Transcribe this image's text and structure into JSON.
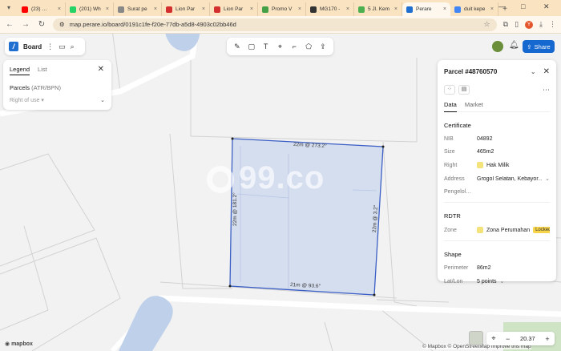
{
  "browser": {
    "tabs": [
      {
        "label": "(23) …",
        "color": "#ff0000",
        "active": false
      },
      {
        "label": "(201) Wh",
        "color": "#25d366",
        "active": false
      },
      {
        "label": "Surat pe",
        "color": "#888888",
        "active": false
      },
      {
        "label": "Lion Par",
        "color": "#d32f2f",
        "active": false
      },
      {
        "label": "Lion Par",
        "color": "#d32f2f",
        "active": false
      },
      {
        "label": "Promo V",
        "color": "#43a047",
        "active": false
      },
      {
        "label": "MG170 -",
        "color": "#333333",
        "active": false
      },
      {
        "label": "5 Jl. Kem",
        "color": "#4caf50",
        "active": false
      },
      {
        "label": "Perare",
        "color": "#1f6fd1",
        "active": true
      },
      {
        "label": "duit kepe",
        "color": "#4285f4",
        "active": false
      }
    ],
    "url": "map.perare.io/board/0191c1fe-f20e-77db-a5d8-4903c02bb46d",
    "profile_initial": "Y"
  },
  "board": {
    "title": "Board"
  },
  "legend": {
    "tab_legend": "Legend",
    "tab_list": "List",
    "layer_name": "Parcels",
    "layer_sub": "(ATR/BPN)",
    "filter": "Right of use"
  },
  "share": {
    "label": "Share"
  },
  "parcel": {
    "title": "Parcel #48760570",
    "tab_data": "Data",
    "tab_market": "Market",
    "certificate_heading": "Certificate",
    "fields": {
      "nib_label": "NIB",
      "nib_value": "04892",
      "size_label": "Size",
      "size_value": "465m2",
      "right_label": "Right",
      "right_value": "Hak Milik",
      "address_label": "Address",
      "address_value": "Grogol Selatan, Kebayor…",
      "pengelola_label": "Pengelol…",
      "pengelola_value": ""
    },
    "rdtr_heading": "RDTR",
    "zone_label": "Zone",
    "zone_value": "Zona Perumahan",
    "zone_badge": "Locked",
    "shape_heading": "Shape",
    "perimeter_label": "Perimeter",
    "perimeter_value": "86m2",
    "latlon_label": "Lat/Lon",
    "latlon_value": "5 points"
  },
  "map": {
    "watermark": "99.co",
    "edge_top": "22m @ 273.2°",
    "edge_right": "22m @ 3.2°",
    "edge_bottom": "21m @ 93.6°",
    "edge_left": "22m @ 181.2°",
    "parcel_fill": "#c9d6ee",
    "parcel_stroke": "#3b5fc4"
  },
  "controls": {
    "zoom": "20.37",
    "mapbox": "mapbox",
    "attribution": "© Mapbox © OpenStreetMap Improve this map"
  }
}
